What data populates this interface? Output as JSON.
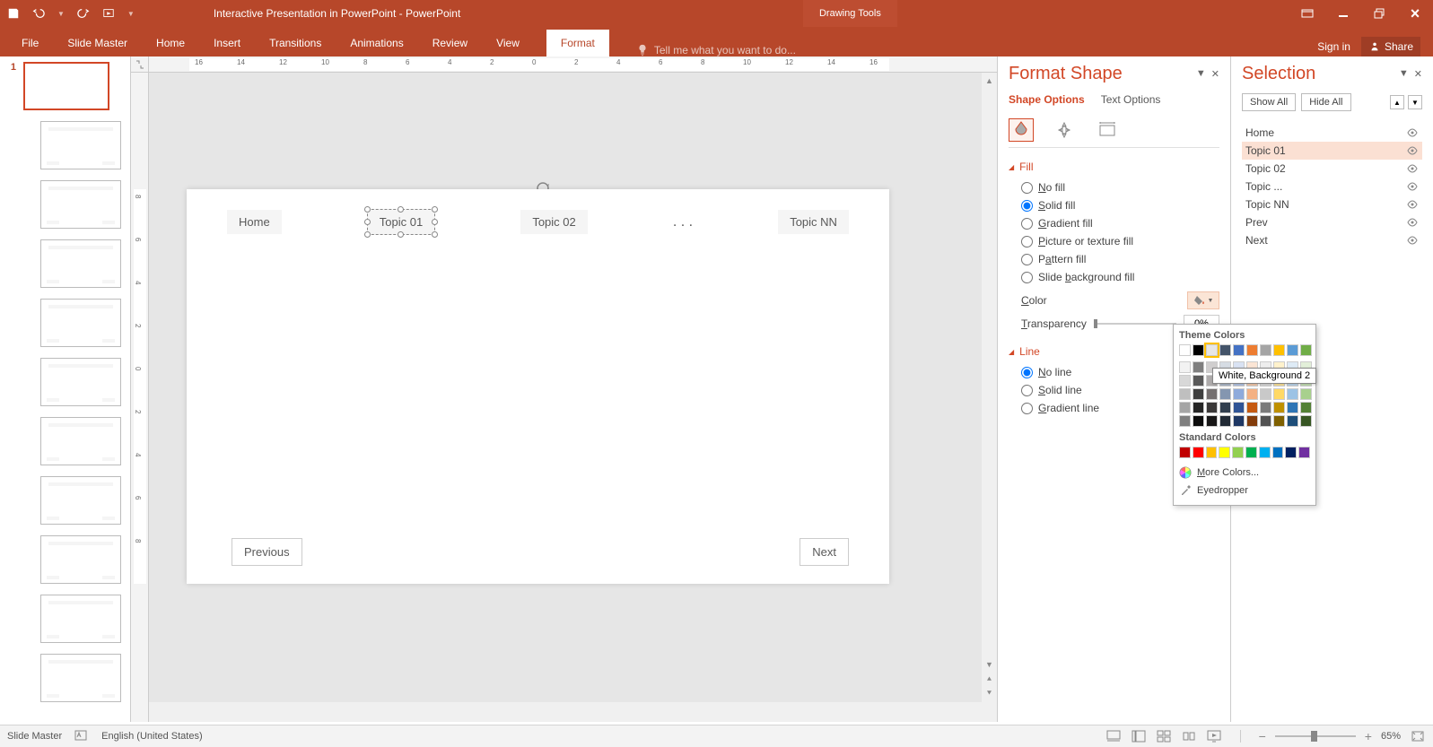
{
  "app": {
    "title": "Interactive Presentation in PowerPoint - PowerPoint",
    "contextual_tab_group": "Drawing Tools"
  },
  "ribbon": {
    "tabs": [
      "File",
      "Slide Master",
      "Home",
      "Insert",
      "Transitions",
      "Animations",
      "Review",
      "View",
      "Format"
    ],
    "active_tab": "Format",
    "tellme_placeholder": "Tell me what you want to do...",
    "signin": "Sign in",
    "share": "Share"
  },
  "thumbnails": {
    "count": 11,
    "selected": 1
  },
  "slide": {
    "nav_items": [
      "Home",
      "Topic 01",
      "Topic 02",
      ". . .",
      "Topic NN"
    ],
    "selected_nav": "Topic 01",
    "prev_label": "Previous",
    "next_label": "Next"
  },
  "format_shape": {
    "title": "Format Shape",
    "tabs": {
      "shape_options": "Shape Options",
      "text_options": "Text Options"
    },
    "sections": {
      "fill": {
        "label": "Fill",
        "options": {
          "no_fill": "No fill",
          "solid_fill": "Solid fill",
          "gradient_fill": "Gradient fill",
          "picture_fill": "Picture or texture fill",
          "pattern_fill": "Pattern fill",
          "slide_bg": "Slide background fill"
        },
        "selected": "solid_fill",
        "color_label": "Color",
        "transparency_label": "Transparency",
        "transparency_value": "0%"
      },
      "line": {
        "label": "Line",
        "options": {
          "no_line": "No line",
          "solid_line": "Solid line",
          "gradient_line": "Gradient line"
        },
        "selected": "no_line"
      }
    }
  },
  "color_picker": {
    "theme_label": "Theme Colors",
    "tooltip": "White, Background 2",
    "standard_label": "Standard Colors",
    "theme_colors_row": [
      "#ffffff",
      "#000000",
      "#e7e6e6",
      "#44546a",
      "#4472c4",
      "#ed7d31",
      "#a5a5a5",
      "#ffc000",
      "#5b9bd5",
      "#70ad47"
    ],
    "theme_tints": [
      [
        "#f2f2f2",
        "#7f7f7f",
        "#d0cece",
        "#d6dce4",
        "#d9e2f3",
        "#fbe5d5",
        "#ededed",
        "#fff2cc",
        "#deebf6",
        "#e2efd9"
      ],
      [
        "#d8d8d8",
        "#595959",
        "#aeabab",
        "#adb9ca",
        "#b4c6e7",
        "#f7cbac",
        "#dbdbdb",
        "#fee599",
        "#bdd7ee",
        "#c5e0b3"
      ],
      [
        "#bfbfbf",
        "#3f3f3f",
        "#757070",
        "#8496b0",
        "#8eaadb",
        "#f4b183",
        "#c9c9c9",
        "#ffd965",
        "#9cc3e5",
        "#a8d08d"
      ],
      [
        "#a5a5a5",
        "#262626",
        "#3a3838",
        "#323f4f",
        "#2f5496",
        "#c55a11",
        "#7b7b7b",
        "#bf9000",
        "#2e75b5",
        "#538135"
      ],
      [
        "#7f7f7f",
        "#0c0c0c",
        "#171616",
        "#222a35",
        "#1f3864",
        "#833c0b",
        "#525252",
        "#7f6000",
        "#1e4e79",
        "#375623"
      ]
    ],
    "standard_colors": [
      "#c00000",
      "#ff0000",
      "#ffc000",
      "#ffff00",
      "#92d050",
      "#00b050",
      "#00b0f0",
      "#0070c0",
      "#002060",
      "#7030a0"
    ],
    "more_colors": "More Colors...",
    "eyedropper": "Eyedropper"
  },
  "selection": {
    "title": "Selection",
    "show_all": "Show All",
    "hide_all": "Hide All",
    "items": [
      "Home",
      "Topic 01",
      "Topic 02",
      "Topic ...",
      "Topic NN",
      "Prev",
      "Next"
    ],
    "active": "Topic 01"
  },
  "status": {
    "mode": "Slide Master",
    "language": "English (United States)",
    "zoom": "65%"
  },
  "ruler": {
    "h_labels": [
      "16",
      "14",
      "12",
      "10",
      "8",
      "6",
      "4",
      "2",
      "0",
      "2",
      "4",
      "6",
      "8",
      "10",
      "12",
      "14",
      "16"
    ],
    "v_labels": [
      "8",
      "6",
      "4",
      "2",
      "0",
      "2",
      "4",
      "6",
      "8"
    ]
  }
}
